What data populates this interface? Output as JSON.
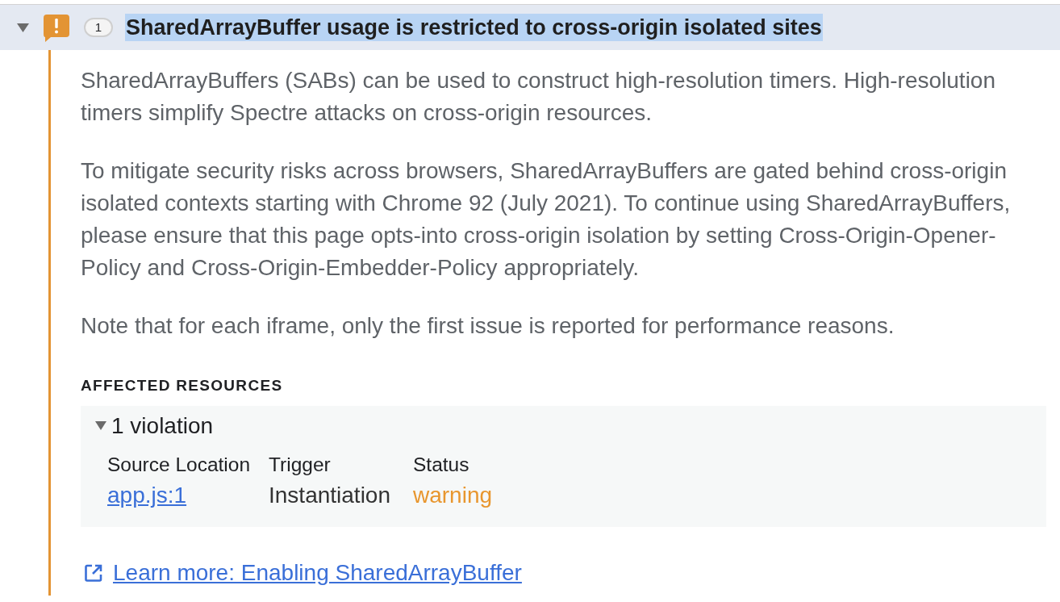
{
  "issue": {
    "expanded": true,
    "kind": "warning",
    "count": "1",
    "title": "SharedArrayBuffer usage is restricted to cross-origin isolated sites",
    "highlighted": true
  },
  "paragraphs": [
    "SharedArrayBuffers (SABs) can be used to construct high-resolution timers. High-resolution timers simplify Spectre attacks on cross-origin resources.",
    "To mitigate security risks across browsers, SharedArrayBuffers are gated behind cross-origin isolated contexts starting with Chrome 92 (July 2021). To continue using SharedArrayBuffers, please ensure that this page opts-into cross-origin isolation by setting Cross-Origin-Opener-Policy and Cross-Origin-Embedder-Policy appropriately.",
    "Note that for each iframe, only the first issue is reported for performance reasons."
  ],
  "affected_resources": {
    "heading": "AFFECTED RESOURCES",
    "group": {
      "expanded": true,
      "label": "1 violation",
      "columns": [
        "Source Location",
        "Trigger",
        "Status"
      ],
      "rows": [
        {
          "source_location": "app.js:1",
          "trigger": "Instantiation",
          "status": {
            "text": "warning",
            "color": "#e8962e"
          }
        }
      ]
    }
  },
  "learn_more": {
    "label": "Learn more: Enabling SharedArrayBuffer"
  }
}
